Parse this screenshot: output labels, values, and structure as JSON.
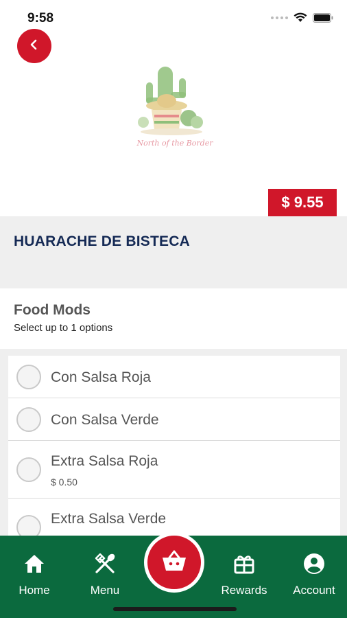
{
  "status_bar": {
    "time": "9:58"
  },
  "header": {
    "back_icon": "chevron-left-icon",
    "logo_text": "North of the Border"
  },
  "price": "$ 9.55",
  "item": {
    "title": "HUARACHE DE BISTECA"
  },
  "mods": {
    "title": "Food Mods",
    "subtitle": "Select up to 1 options",
    "options": [
      {
        "label": "Con Salsa Roja",
        "price": ""
      },
      {
        "label": "Con Salsa Verde",
        "price": ""
      },
      {
        "label": "Extra Salsa Roja",
        "price": "$ 0.50"
      },
      {
        "label": "Extra Salsa Verde",
        "price": ""
      }
    ]
  },
  "nav": {
    "home": {
      "label": "Home",
      "icon": "home-icon"
    },
    "menu": {
      "label": "Menu",
      "icon": "utensils-icon"
    },
    "cart": {
      "icon": "basket-icon"
    },
    "rewards": {
      "label": "Rewards",
      "icon": "gift-icon"
    },
    "account": {
      "label": "Account",
      "icon": "account-icon"
    }
  },
  "colors": {
    "accent_red": "#d0172a",
    "nav_green": "#0b6a3e",
    "title_navy": "#152a55"
  }
}
